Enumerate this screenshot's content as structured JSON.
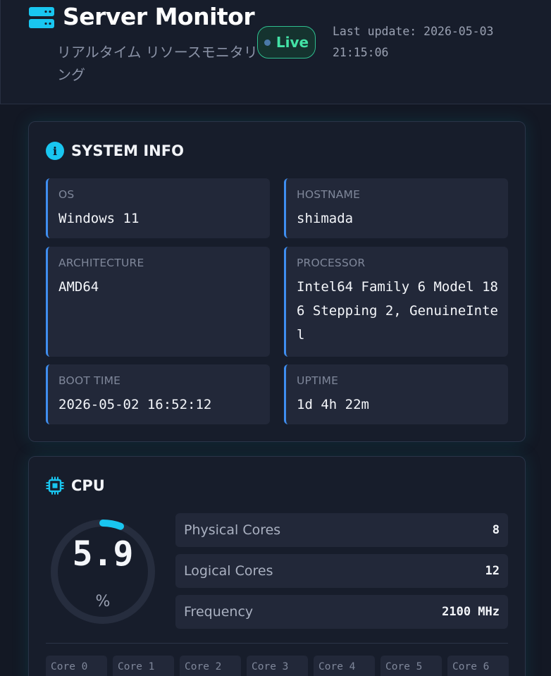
{
  "header": {
    "title": "Server Monitor",
    "subtitle": "リアルタイム リソースモニタリング",
    "live_label": "Live",
    "last_update": "Last update: 2026-05-03 21:15:06"
  },
  "system_info": {
    "title": "SYSTEM INFO",
    "os": {
      "label": "OS",
      "value": "Windows 11"
    },
    "hostname": {
      "label": "HOSTNAME",
      "value": "shimada"
    },
    "architecture": {
      "label": "ARCHITECTURE",
      "value": "AMD64"
    },
    "processor": {
      "label": "PROCESSOR",
      "value": "Intel64 Family 6 Model 186 Stepping 2, GenuineIntel"
    },
    "boot_time": {
      "label": "BOOT TIME",
      "value": "2026-05-02 16:52:12"
    },
    "uptime": {
      "label": "UPTIME",
      "value": "1d 4h 22m"
    }
  },
  "cpu": {
    "title": "CPU",
    "usage": "5.9",
    "usage_percent": 5.9,
    "unit": "%",
    "stats": [
      {
        "label": "Physical Cores",
        "value": "8"
      },
      {
        "label": "Logical Cores",
        "value": "12"
      },
      {
        "label": "Frequency",
        "value": "2100 MHz"
      }
    ],
    "cores": [
      "Core 0",
      "Core 1",
      "Core 2",
      "Core 3",
      "Core 4",
      "Core 5",
      "Core 6"
    ]
  },
  "colors": {
    "accent": "#19c6f0",
    "live": "#43e3a6",
    "tile_border": "#3f8ef0"
  }
}
